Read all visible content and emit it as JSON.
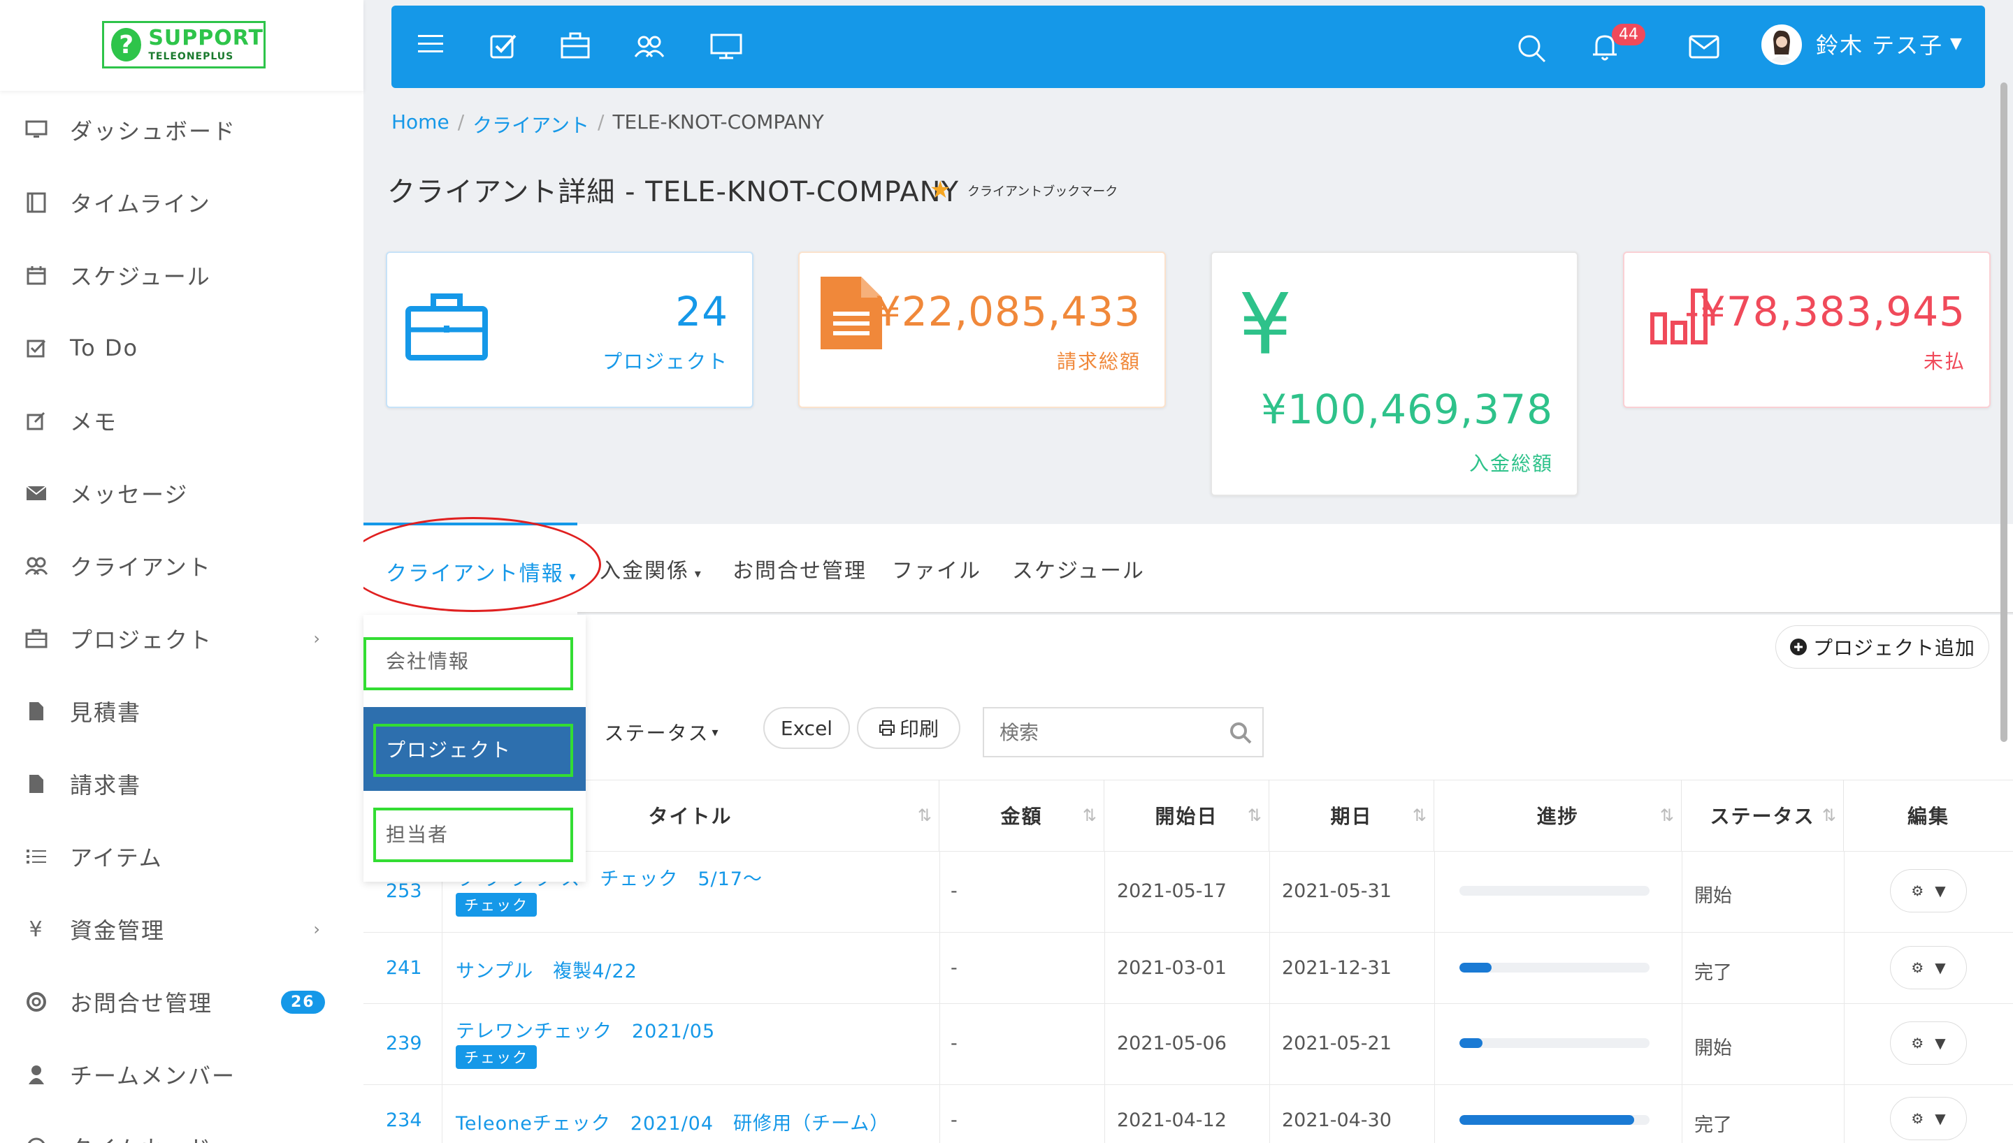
{
  "logo": {
    "icon_text": "?",
    "main": "SUPPORT",
    "sub": "TELEONEPLUS"
  },
  "sidebar": {
    "items": [
      {
        "label": "ダッシュボード",
        "icon": "monitor-icon"
      },
      {
        "label": "タイムライン",
        "icon": "timeline-icon"
      },
      {
        "label": "スケジュール",
        "icon": "calendar-icon"
      },
      {
        "label": "To Do",
        "icon": "checkbox-icon"
      },
      {
        "label": "メモ",
        "icon": "edit-icon"
      },
      {
        "label": "メッセージ",
        "icon": "envelope-icon"
      },
      {
        "label": "クライアント",
        "icon": "users-icon"
      },
      {
        "label": "プロジェクト",
        "icon": "briefcase-icon"
      },
      {
        "label": "見積書",
        "icon": "file-icon"
      },
      {
        "label": "請求書",
        "icon": "file-icon"
      },
      {
        "label": "アイテム",
        "icon": "list-icon"
      },
      {
        "label": "資金管理",
        "icon": "yen-icon"
      },
      {
        "label": "お問合せ管理",
        "icon": "lifebuoy-icon",
        "badge": "26"
      },
      {
        "label": "チームメンバー",
        "icon": "user-icon"
      },
      {
        "label": "タイムカード",
        "icon": "clock-icon"
      }
    ]
  },
  "topbar": {
    "bell_count": "44",
    "user_name": "鈴木 テス子"
  },
  "breadcrumb": {
    "home": "Home",
    "sep": "/",
    "client": "クライアント",
    "current": "TELE-KNOT-COMPANY"
  },
  "page": {
    "title": "クライアント詳細 - TELE-KNOT-COMPANY",
    "bookmark_label": "クライアントブックマーク"
  },
  "cards": [
    {
      "value": "24",
      "label": "プロジェクト",
      "color": "#1598e8"
    },
    {
      "value": "¥22,085,433",
      "label": "請求総額",
      "color": "#f0883a"
    },
    {
      "value": "¥100,469,378",
      "label": "入金総額",
      "color": "#2ec28a"
    },
    {
      "value": "-¥78,383,945",
      "label": "未払",
      "color": "#f04a5a"
    }
  ],
  "tabs": {
    "client_info": "クライアント情報",
    "payments": "入金関係",
    "inquiries": "お問合せ管理",
    "files": "ファイル",
    "schedule": "スケジュール"
  },
  "dropdown": {
    "company": "会社情報",
    "project": "プロジェクト",
    "contact": "担当者"
  },
  "toolbar": {
    "add_project": "プロジェクト追加",
    "status_filter": "ステータス",
    "excel": "Excel",
    "print": "印刷",
    "search_placeholder": "検索"
  },
  "table": {
    "headers": {
      "title": "タイトル",
      "amount": "金額",
      "start": "開始日",
      "due": "期日",
      "progress": "進捗",
      "status": "ステータス",
      "edit": "編集"
    },
    "rows": [
      {
        "id": "253",
        "title": "ラ ラ ラ ク ス　チェック　5/17〜",
        "tag": "チェック",
        "amount": "-",
        "start": "2021-05-17",
        "due": "2021-05-31",
        "progress": 0,
        "status": "開始"
      },
      {
        "id": "241",
        "title": "サンプル　複製4/22",
        "tag": "",
        "amount": "-",
        "start": "2021-03-01",
        "due": "2021-12-31",
        "progress": 17,
        "status": "完了"
      },
      {
        "id": "239",
        "title": "テレワンチェック　2021/05",
        "tag": "チェック",
        "amount": "-",
        "start": "2021-05-06",
        "due": "2021-05-21",
        "progress": 12,
        "status": "開始"
      },
      {
        "id": "234",
        "title": "Teleoneチェック　2021/04　研修用（チーム）",
        "tag": "",
        "amount": "-",
        "start": "2021-04-12",
        "due": "2021-04-30",
        "progress": 92,
        "status": "完了"
      }
    ]
  }
}
